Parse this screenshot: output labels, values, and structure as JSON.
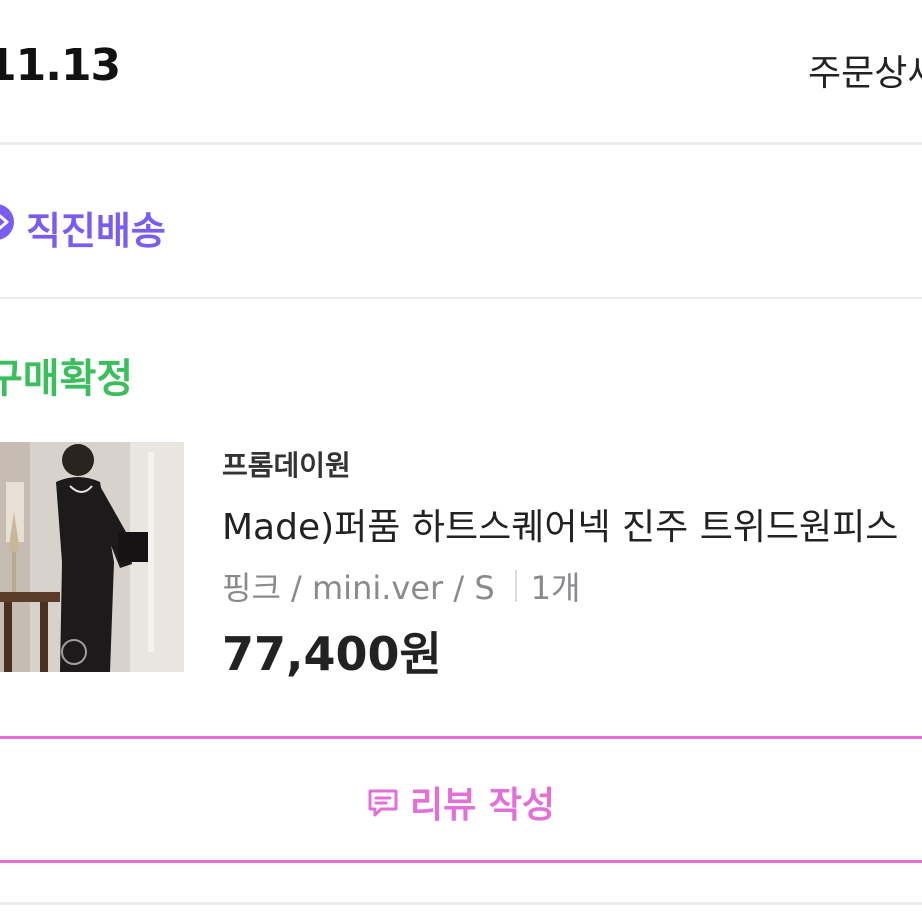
{
  "order": {
    "date": "11.13",
    "detail_link": "주문상세"
  },
  "delivery": {
    "label": "직진배송",
    "accent_color": "#7b5cf0",
    "icon": "chevron-right-icon"
  },
  "item": {
    "status": "구매확정",
    "status_color": "#3bbf5c",
    "brand": "프롬데이원",
    "name": "Made)퍼품 하트스퀘어넥 진주 트위드원피스",
    "option": "핑크 / mini.ver / S",
    "quantity": "1개",
    "price": "77,400원"
  },
  "review": {
    "label": "리뷰 작성",
    "icon": "comment-icon",
    "accent_color": "#e46fd9"
  }
}
